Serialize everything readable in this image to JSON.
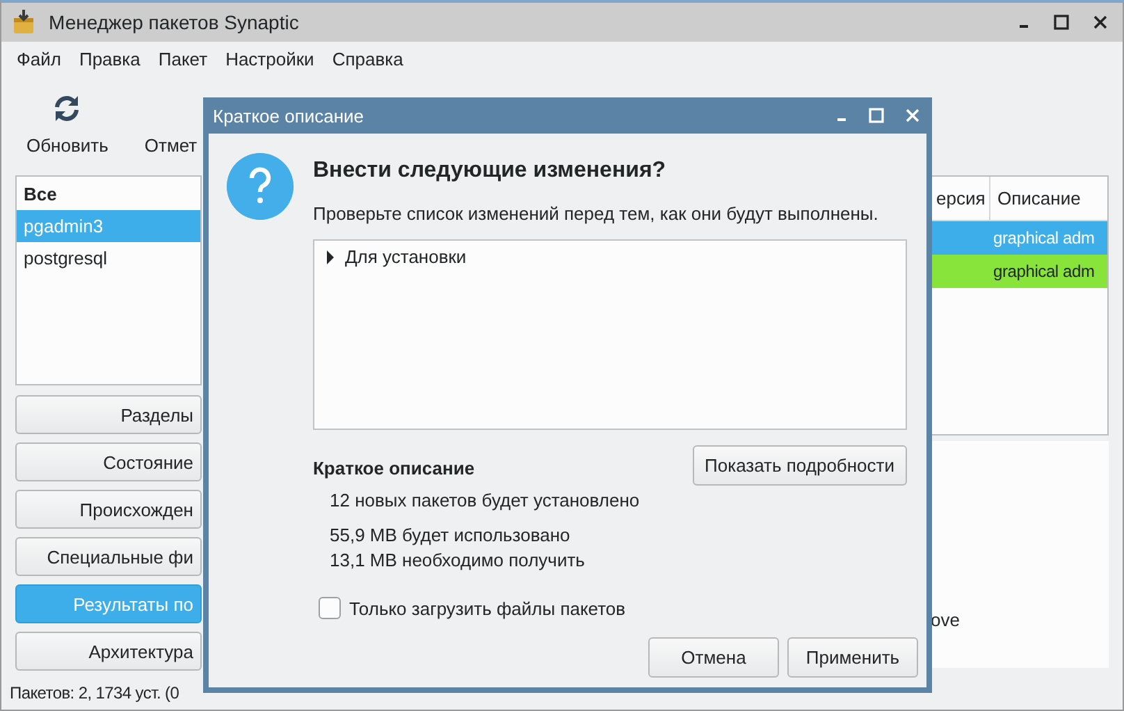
{
  "window": {
    "title": "Менеджер пакетов Synaptic"
  },
  "menu": [
    "Файл",
    "Правка",
    "Пакет",
    "Настройки",
    "Справка"
  ],
  "toolbar": [
    {
      "label": "Обновить",
      "kind": "reload"
    },
    {
      "label": "Отмет",
      "kind": "plain"
    }
  ],
  "filter_list": {
    "header": "Все",
    "items": [
      {
        "label": "pgadmin3",
        "selected": true
      },
      {
        "label": "postgresql",
        "selected": false
      }
    ]
  },
  "filter_buttons": [
    {
      "label": "Разделы",
      "selected": false
    },
    {
      "label": "Состояние",
      "selected": false
    },
    {
      "label": "Происхожден",
      "selected": false
    },
    {
      "label": "Специальные фи",
      "selected": false
    },
    {
      "label": "Результаты по",
      "selected": true
    },
    {
      "label": "Архитектура",
      "selected": false
    }
  ],
  "package_table": {
    "columns": [
      "ерсия",
      "Описание"
    ],
    "rows": [
      {
        "description": "graphical adm",
        "selected": true,
        "marked": false
      },
      {
        "description": "graphical adm",
        "selected": false,
        "marked": true
      }
    ]
  },
  "details": {
    "text": "ove"
  },
  "status_bar": "Пакетов: 2, 1734 уст. (0",
  "dialog": {
    "title": "Краткое описание",
    "heading": "Внести следующие изменения?",
    "subtitle": "Проверьте список изменений перед тем, как они будут выполнены.",
    "tree": [
      {
        "label": "Для установки",
        "expanded": false
      }
    ],
    "summary_title": "Краткое описание",
    "details_button": "Показать подробности",
    "summary_lines": [
      "12 новых пакетов будет установлено",
      "55,9 MB будет использовано",
      "13,1 MB необходимо получить"
    ],
    "checkbox": {
      "label": "Только загрузить файлы пакетов",
      "checked": false
    },
    "buttons": [
      "Отмена",
      "Применить"
    ]
  }
}
